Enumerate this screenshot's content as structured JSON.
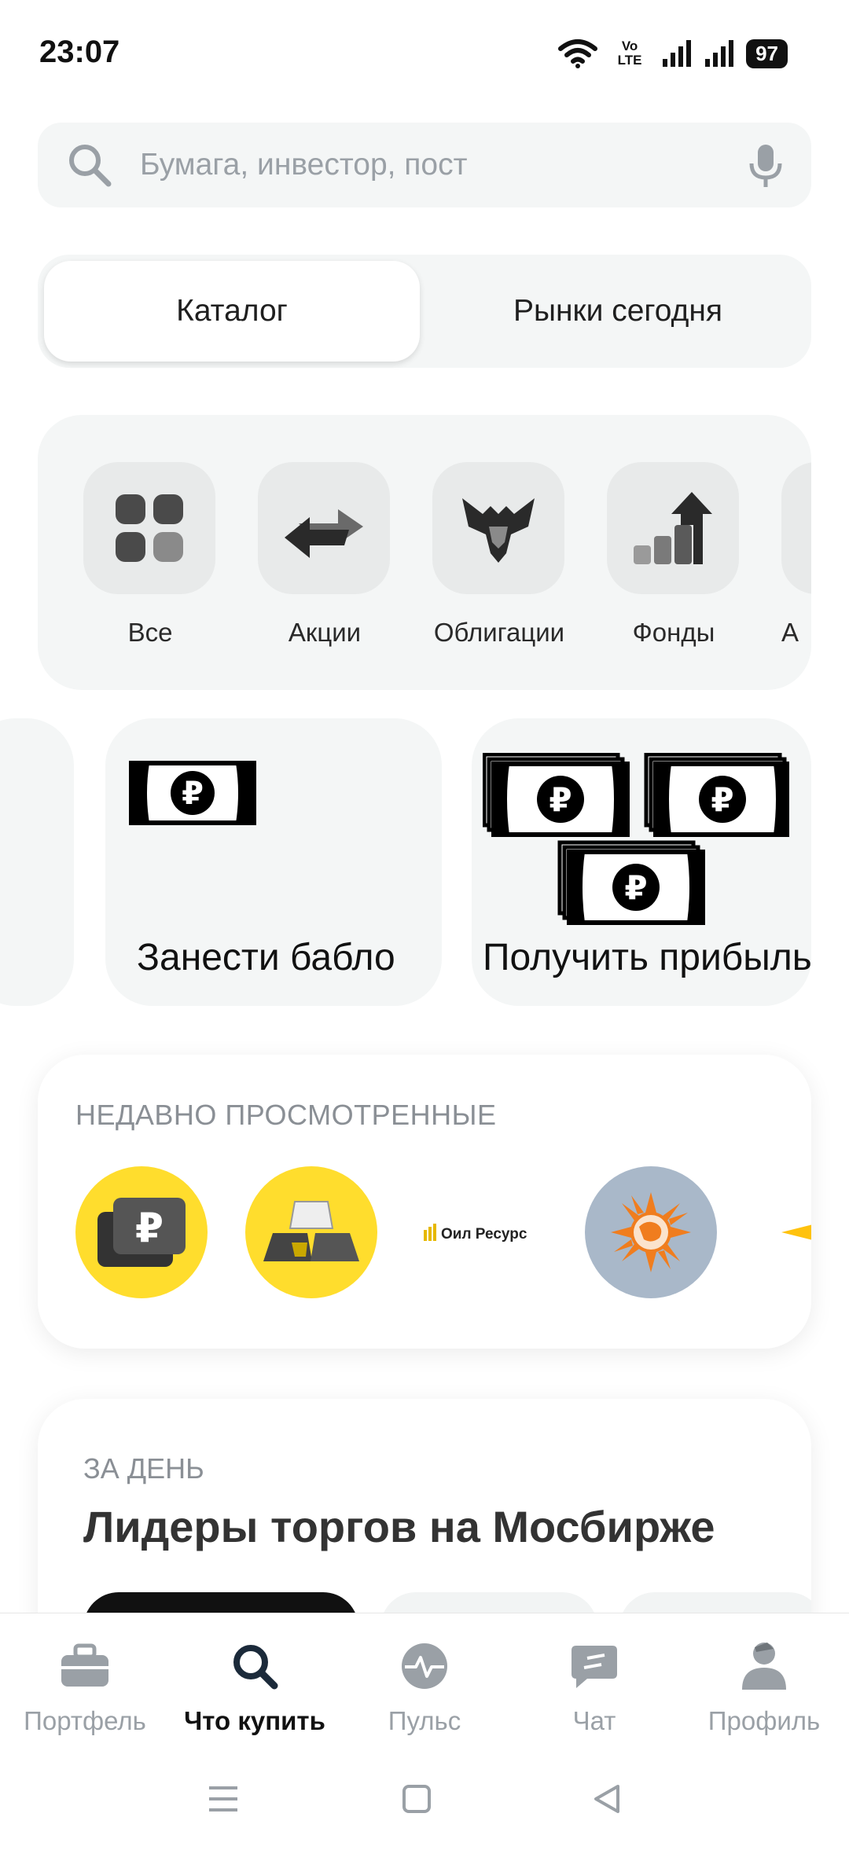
{
  "status_bar": {
    "time": "23:07",
    "battery": "97",
    "network": "Vo LTE"
  },
  "search": {
    "placeholder": "Бумага, инвестор, пост"
  },
  "tabs": [
    {
      "label": "Каталог",
      "active": true
    },
    {
      "label": "Рынки сегодня",
      "active": false
    }
  ],
  "categories": [
    {
      "label": "Все",
      "icon": "grid-icon"
    },
    {
      "label": "Акции",
      "icon": "exchange-arrows-icon"
    },
    {
      "label": "Облигации",
      "icon": "eagle-emblem-icon"
    },
    {
      "label": "Фонды",
      "icon": "growth-steps-icon"
    },
    {
      "label": "А",
      "icon": "partial-category-icon"
    }
  ],
  "promo_cards": [
    {
      "label": "Занести бабло",
      "icon": "ruble-banknote-icon"
    },
    {
      "label": "Получить прибыль",
      "icon": "ruble-banknote-stacks-icon"
    }
  ],
  "recent": {
    "title": "НЕДАВНО ПРОСМОТРЕННЫЕ",
    "items": [
      {
        "name": "ruble-wallet-logo"
      },
      {
        "name": "gold-bars-logo"
      },
      {
        "name": "oil-resource-logo",
        "text": "Оил Ресурс"
      },
      {
        "name": "orange-sun-globe-logo"
      },
      {
        "name": "partial-yellow-logo"
      }
    ]
  },
  "leaders": {
    "subtitle": "ЗА ДЕНЬ",
    "title": "Лидеры торгов на Мосбирже"
  },
  "bottom_nav": [
    {
      "label": "Портфель",
      "icon": "briefcase-icon",
      "active": false
    },
    {
      "label": "Что купить",
      "icon": "search-icon",
      "active": true
    },
    {
      "label": "Пульс",
      "icon": "pulse-icon",
      "active": false
    },
    {
      "label": "Чат",
      "icon": "chat-icon",
      "active": false
    },
    {
      "label": "Профиль",
      "icon": "profile-icon",
      "active": false
    }
  ],
  "colors": {
    "accent_yellow": "#ffdd2d",
    "surface": "#f4f6f6",
    "muted_text": "#9aa0a6"
  }
}
